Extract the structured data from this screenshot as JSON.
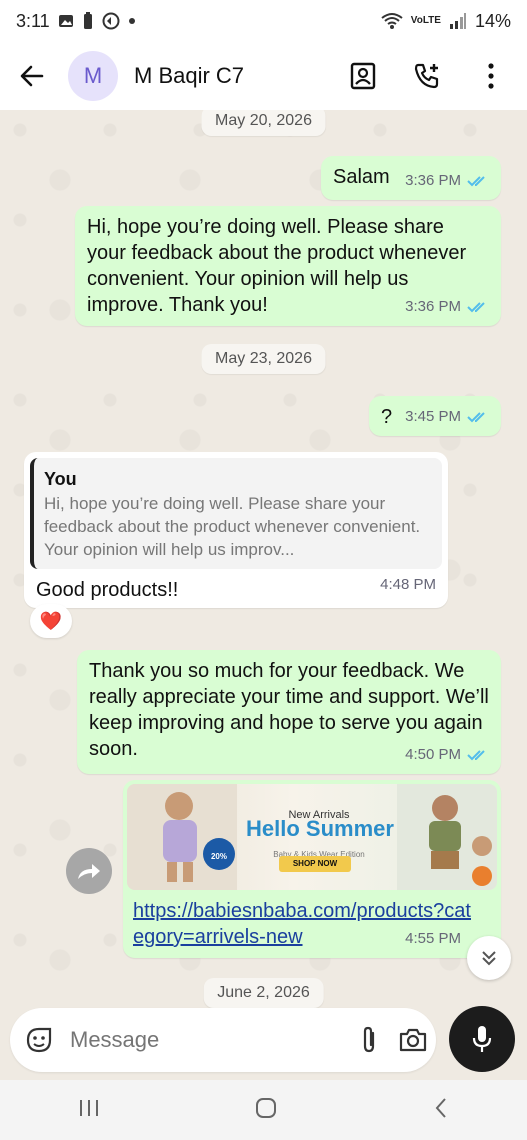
{
  "status_bar": {
    "time": "3:11",
    "battery": "14%",
    "signal_label": "VoLTE"
  },
  "header": {
    "avatar_initial": "M",
    "contact_name": "M Baqir C7"
  },
  "chat": {
    "top_date_chip": "May 20, 2026",
    "messages": [
      {
        "id": "m1",
        "text": "Salam",
        "time": "3:36 PM"
      },
      {
        "id": "m2",
        "text": "Hi, hope you’re doing well. Please share your feedback about the product whenever convenient. Your opinion will help us improve. Thank you!",
        "time": "3:36 PM"
      },
      {
        "id": "m3",
        "text": "?",
        "time": "3:45 PM"
      },
      {
        "id": "m4",
        "quote_author": "You",
        "quote_text": "Hi, hope you’re doing well. Please share your feedback about the product whenever convenient. Your opinion will help us improv...",
        "text": "Good products!!",
        "time": "4:48 PM",
        "reaction": "❤️"
      },
      {
        "id": "m5",
        "text": "Thank you so much for your feedback. We really appreciate your time and support. We’ll keep improving and hope to serve you again soon.",
        "time": "4:50 PM"
      },
      {
        "id": "m6",
        "banner": {
          "tag": "New Arrivals",
          "headline": "Hello Summer",
          "subline": "Baby & Kids Wear Edition",
          "cta": "SHOP NOW",
          "discount": "20%"
        },
        "link": "https://babiesnbaba.com/products?category=arrivels-new",
        "time": "4:55 PM"
      }
    ],
    "date_chips": [
      "May 23, 2026",
      "June 2, 2026"
    ]
  },
  "composer": {
    "placeholder": "Message"
  },
  "colors": {
    "outgoing_bubble": "#d9fdd3",
    "incoming_bubble": "#ffffff",
    "read_tick": "#53bdeb",
    "chat_bg": "#efeae2"
  }
}
